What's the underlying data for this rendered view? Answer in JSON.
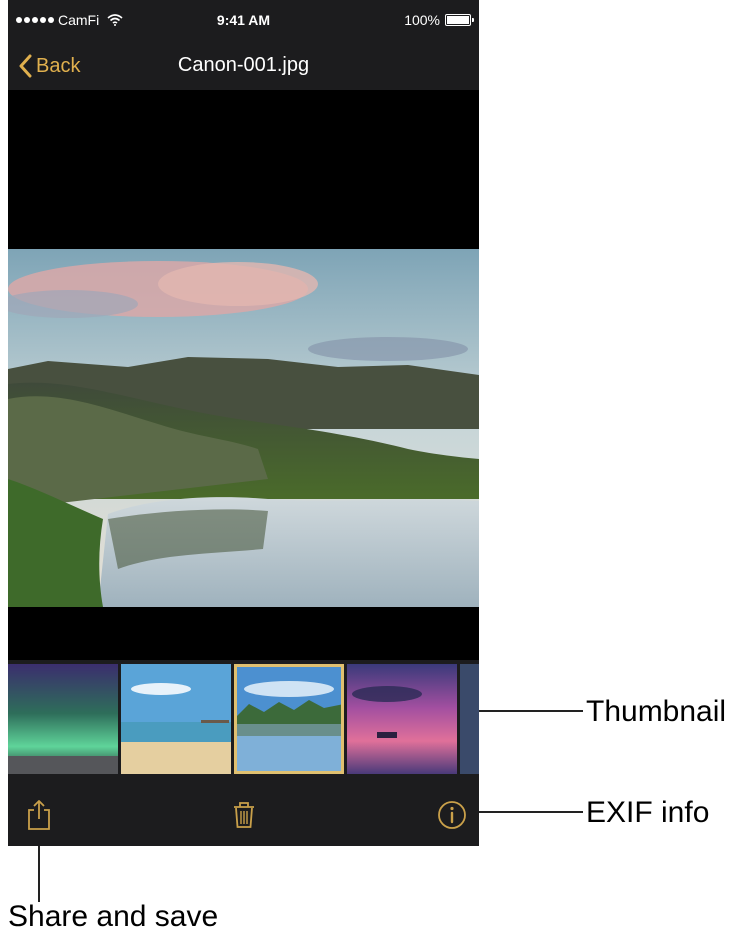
{
  "status_bar": {
    "carrier": "CamFi",
    "time": "9:41 AM",
    "battery": "100%"
  },
  "nav": {
    "back_label": "Back",
    "title": "Canon-001.jpg"
  },
  "annotations": {
    "thumbnail": "Thumbnail",
    "exif": "EXIF info",
    "share": "Share and save"
  },
  "colors": {
    "accent": "#e0b04e",
    "bar": "#1c1c1e",
    "selected_outline": "#e0c070"
  },
  "icons": {
    "share": "share-icon",
    "delete": "trash-icon",
    "info": "info-icon"
  }
}
